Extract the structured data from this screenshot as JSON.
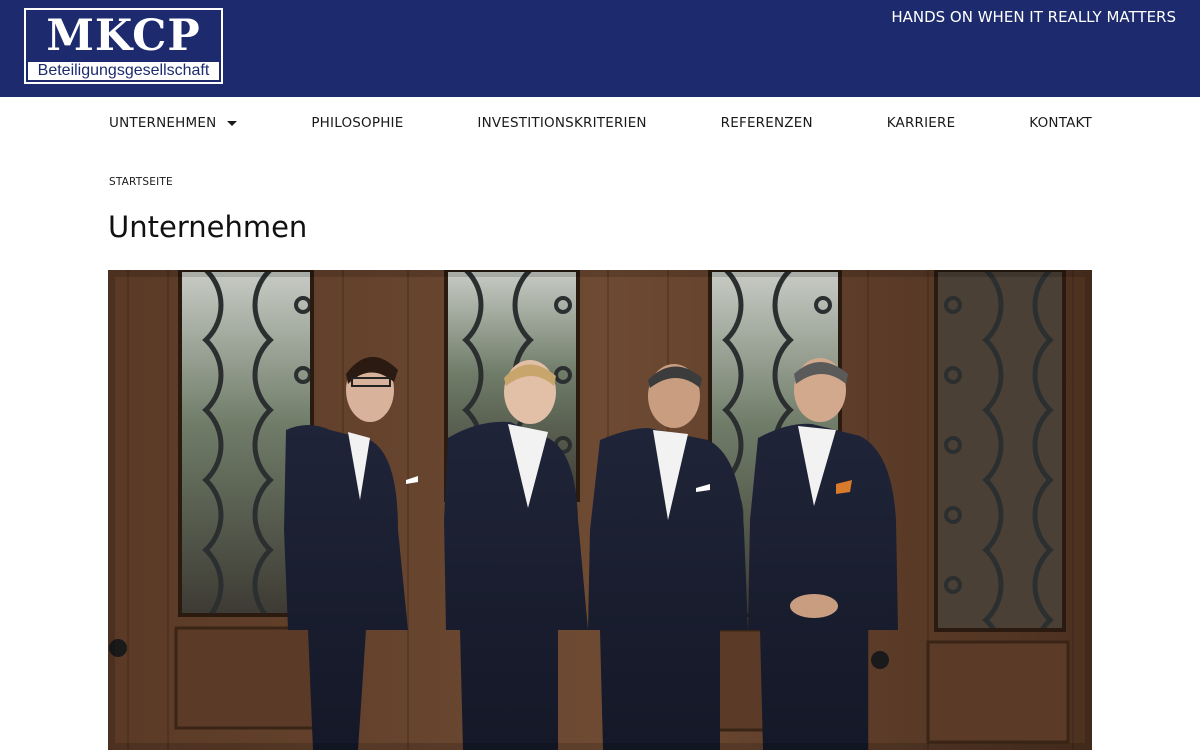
{
  "header": {
    "logo_mark": "MKCP",
    "logo_sub": "Beteiligungsgesellschaft",
    "tagline": "HANDS ON WHEN IT REALLY MATTERS",
    "brand_color": "#1d2b6e"
  },
  "nav": {
    "items": [
      {
        "label": "UNTERNEHMEN",
        "has_dropdown": true
      },
      {
        "label": "PHILOSOPHIE"
      },
      {
        "label": "INVESTITIONSKRITERIEN"
      },
      {
        "label": "REFERENZEN"
      },
      {
        "label": "KARRIERE"
      },
      {
        "label": "KONTAKT"
      }
    ],
    "dropdown_icon": "chevron-down-icon"
  },
  "breadcrumb": {
    "home": "STARTSEITE"
  },
  "page": {
    "title": "Unternehmen"
  }
}
